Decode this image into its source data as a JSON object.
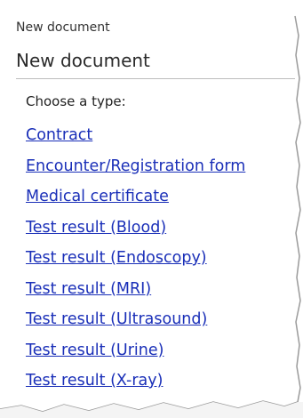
{
  "header": {
    "caption": "New document",
    "title": "New document"
  },
  "menu": {
    "prompt": "Choose a type:",
    "items": [
      {
        "label": "Contract"
      },
      {
        "label": "Encounter/Registration form"
      },
      {
        "label": "Medical certificate"
      },
      {
        "label": "Test result (Blood)"
      },
      {
        "label": "Test result (Endoscopy)"
      },
      {
        "label": "Test result (MRI)"
      },
      {
        "label": "Test result (Ultrasound)"
      },
      {
        "label": "Test result (Urine)"
      },
      {
        "label": "Test result (X-ray)"
      }
    ]
  },
  "colors": {
    "link": "#1a2fb8",
    "text": "#2b2b2b",
    "divider": "#bdbdbd"
  }
}
